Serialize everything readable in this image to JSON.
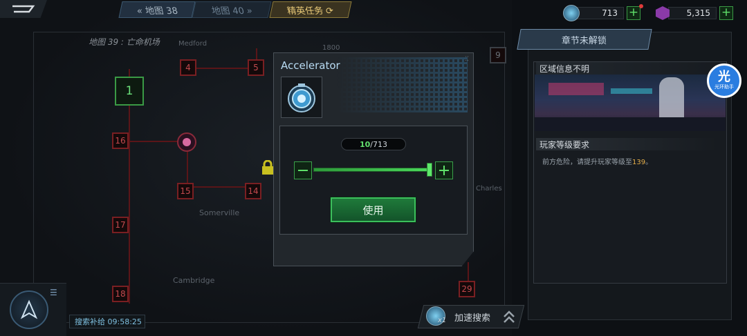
{
  "topbar": {
    "prev_map": "地图 38",
    "next_map": "地图 40",
    "elite": "精英任务"
  },
  "currency": {
    "gems": "713",
    "crystals": "5,315"
  },
  "map": {
    "title": "地图 39 : 亡命机场",
    "labels": {
      "medford": "Medford",
      "somerville": "Somerville",
      "cambridge": "Cambridge",
      "charles": "Charles",
      "top_num": "1800"
    },
    "nodes": {
      "n1": "1",
      "n4": "4",
      "n5": "5",
      "n16": "16",
      "n15": "15",
      "n14": "14",
      "n17": "17",
      "n18": "18",
      "n29": "29",
      "n9": "9"
    }
  },
  "modal": {
    "title": "Accelerator",
    "count_current": "10",
    "count_max": "/713",
    "use_label": "使用",
    "slider_fraction": 0.986
  },
  "side": {
    "chapter": "章节未解锁",
    "region": "区域信息不明",
    "requirement_head": "玩家等级要求",
    "requirement_text": "前方危险，请提升玩家等级至",
    "requirement_level": "139",
    "requirement_end": "。"
  },
  "badge": {
    "char": "光",
    "text": "光环助手"
  },
  "bottom": {
    "supply": "搜索补给 09:58:25",
    "search": "加速搜索",
    "search_count": "x1"
  },
  "colors": {
    "accent_green": "#4ad85a",
    "level_gold": "#e8b04a",
    "node_red": "#c44a4e"
  }
}
